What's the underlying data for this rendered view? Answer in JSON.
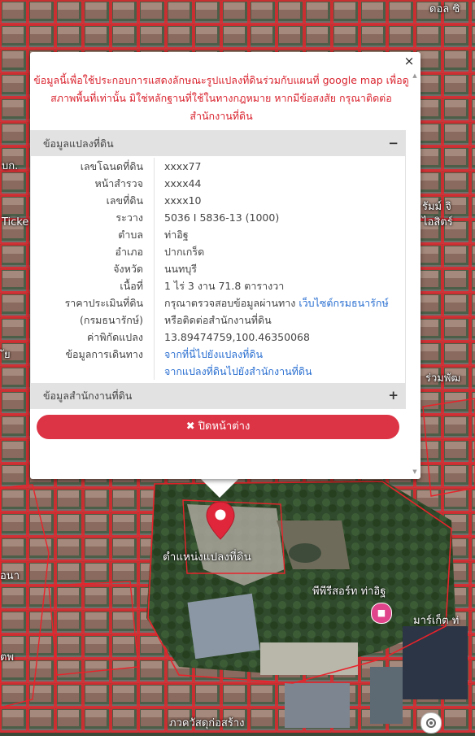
{
  "notice": "ข้อมูลนี้เพื่อใช้ประกอบการแสดงลักษณะรูปแปลงที่ดินร่วมกับแผนที่ google map เพื่อดูสภาพพื้นที่เท่านั้น มิใช่หลักฐานที่ใช้ในทางกฎหมาย หากมีข้อสงสัย กรุณาติดต่อสำนักงานที่ดิน",
  "close_symbol": "×",
  "panel1": {
    "title": "ข้อมูลแปลงที่ดิน",
    "toggle": "−",
    "rows": {
      "deed_no": {
        "label": "เลขโฉนดที่ดิน",
        "value": "xxxx77"
      },
      "survey_page": {
        "label": "หน้าสำรวจ",
        "value": "xxxx44"
      },
      "land_no": {
        "label": "เลขที่ดิน",
        "value": "xxxx10"
      },
      "grid": {
        "label": "ระวาง",
        "value": "5036 I 5836-13 (1000)"
      },
      "subdistrict": {
        "label": "ตำบล",
        "value": "ท่าอิฐ"
      },
      "district": {
        "label": "อำเภอ",
        "value": "ปากเกร็ด"
      },
      "province": {
        "label": "จังหวัด",
        "value": "นนทบุรี"
      },
      "area": {
        "label": "เนื้อที่",
        "value": "1 ไร่ 3 งาน 71.8 ตารางวา"
      },
      "appraisal": {
        "label": "ราคาประเมินที่ดิน",
        "label2": "(กรมธนารักษ์)",
        "value_prefix": "กรุณาตรวจสอบข้อมูลผ่านทาง ",
        "value_link": "เว็บไซต์กรมธนารักษ์",
        "value_line2": "หรือติดต่อสำนักงานที่ดิน"
      },
      "coords": {
        "label": "ค่าพิกัดแปลง",
        "value": "13.89474759,100.46350068"
      },
      "travel": {
        "label": "ข้อมูลการเดินทาง",
        "link1": "จากที่นี่ไปยังแปลงที่ดิน",
        "link2": "จากแปลงที่ดินไปยังสำนักงานที่ดิน"
      }
    }
  },
  "panel2": {
    "title": "ข้อมูลสำนักงานที่ดิน",
    "toggle": "+"
  },
  "close_button": {
    "icon": "✖",
    "label": "ปิดหน้าต่าง"
  },
  "map": {
    "pin_label": "ตำแหน่งแปลงที่ดิน",
    "labels": {
      "top_right": "ดอล ซิ",
      "ticket": "Ticke",
      "l1": "บก.",
      "left_mid": "ัย",
      "resort": "พีพีรีสอร์ท ท่าอิฐ",
      "market": "มาร์เก็ต ท่",
      "bottom": "ภวควัสดุก่อสร้าง",
      "right1": "ร่วมพัฒ",
      "right2": "รัมม์ จิ",
      "right3": "ไอสิตร์",
      "left_low": "อนา",
      "left_bottom": "ตพ"
    },
    "colors": {
      "parcel": "#e8232b",
      "popup_notice": "#d9232e",
      "button": "#dc3445",
      "link": "#2a6fd1",
      "pin": "#e0263a"
    }
  }
}
